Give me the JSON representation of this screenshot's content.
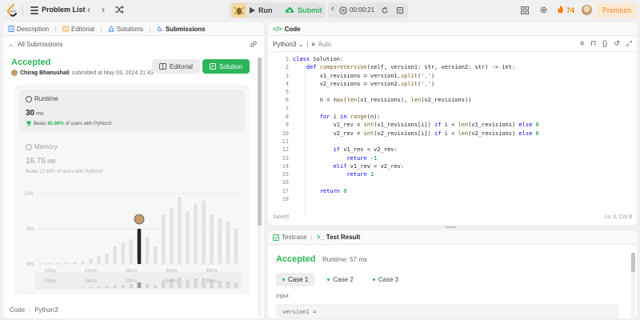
{
  "topbar": {
    "problem_list": "Problem List",
    "run": "Run",
    "submit": "Submit",
    "timer": "00:00:21",
    "streak": "74",
    "premium": "Premium"
  },
  "left": {
    "tabs": [
      "Description",
      "Editorial",
      "Solutions",
      "Submissions"
    ],
    "back": "All Submissions",
    "status": "Accepted",
    "author": "Chirag Bhanushali",
    "submitted": "submitted at May 03, 2024 21:43",
    "editorial_btn": "Editorial",
    "solution_btn": "Solution",
    "runtime_label": "Runtime",
    "runtime_value": "30",
    "runtime_unit": "ms",
    "beats_prefix": "Beats",
    "beats_pct": "85.86%",
    "beats_suffix": "of users with Python3",
    "memory_label": "Memory",
    "memory_value": "16.76",
    "memory_unit": "MB",
    "memory_beats": "Beats 13.68% of users with Python3",
    "code_label": "Code",
    "code_lang": "Python3"
  },
  "chart_data": {
    "type": "bar",
    "ytick_labels": [
      "10%",
      "5%",
      "0%"
    ],
    "xtick_labels": [
      "19ms",
      "24ms",
      "29ms",
      "34ms",
      "39ms"
    ],
    "yticks": [
      10,
      5,
      0
    ],
    "xticks": [
      19,
      24,
      29,
      34,
      39
    ],
    "ylim": [
      0,
      10
    ],
    "x": [
      18,
      19,
      20,
      21,
      22,
      23,
      24,
      25,
      26,
      27,
      28,
      29,
      30,
      31,
      32,
      33,
      34,
      35,
      36,
      37,
      38,
      39,
      40,
      41,
      42
    ],
    "values": [
      0.1,
      0.2,
      0.2,
      0.3,
      0.3,
      0.5,
      0.8,
      1.2,
      1.5,
      2.5,
      3.0,
      3.5,
      5.0,
      3.8,
      2.5,
      7.0,
      8.0,
      9.5,
      7.5,
      8.5,
      9.0,
      7.0,
      6.5,
      6.0,
      5.0
    ],
    "highlight_x": 30
  },
  "code": {
    "header": "Code",
    "lang": "Python3",
    "auto": "Auto",
    "line_numbers": [
      "1",
      "2",
      "3",
      "4",
      "5",
      "6",
      "7",
      "8",
      "9",
      "10",
      "11",
      "12",
      "13",
      "14",
      "15",
      "16",
      "17",
      "18"
    ],
    "lines": [
      "class Solution:",
      "    def compareVersion(self, version1: str, version2: str) -> int:",
      "        v1_revisions = version1.split('.')",
      "        v2_revisions = version2.split('.')",
      "",
      "        n = max(len(v1_revisions), len(v2_revisions))",
      "",
      "        for i in range(n):",
      "            v1_rev = int(v1_revisions[i]) if i < len(v1_revisions) else 0",
      "            v2_rev = int(v2_revisions[i]) if i < len(v2_revisions) else 0",
      "",
      "            if v1_rev < v2_rev:",
      "                return -1",
      "            elif v1_rev > v2_rev:",
      "                return 1",
      "",
      "        return 0",
      ""
    ],
    "saved": "Saved",
    "cursor": "Ln 3, Col 8"
  },
  "result": {
    "tab_testcase": "Testcase",
    "tab_result": "Test Result",
    "status": "Accepted",
    "runtime": "Runtime: 57 ms",
    "cases": [
      "Case 1",
      "Case 2",
      "Case 3"
    ],
    "input_label": "Input",
    "input_value": "version1 ="
  },
  "colors": {
    "accent_green": "#2db55d",
    "premium_orange": "#f08a24",
    "highlight_bar": "#262626"
  }
}
